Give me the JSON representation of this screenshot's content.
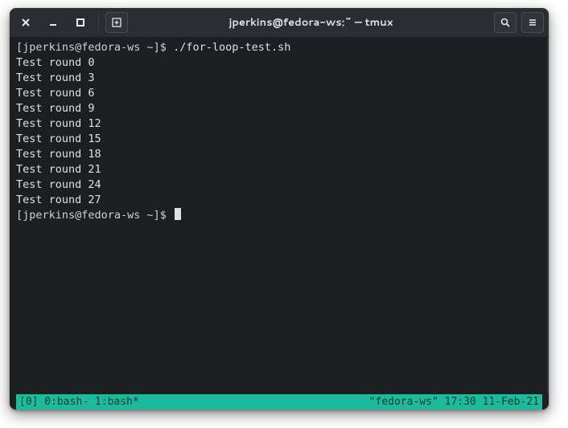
{
  "titlebar": {
    "title": "jperkins@fedora-ws:~ — tmux"
  },
  "terminal": {
    "prompt": "[jperkins@fedora-ws ~]$",
    "command": "./for-loop-test.sh",
    "output": [
      "Test round 0",
      "Test round 3",
      "Test round 6",
      "Test round 9",
      "Test round 12",
      "Test round 15",
      "Test round 18",
      "Test round 21",
      "Test round 24",
      "Test round 27"
    ],
    "prompt2": "[jperkins@fedora-ws ~]$"
  },
  "statusbar": {
    "left": "[0] 0:bash- 1:bash*",
    "right": "\"fedora-ws\" 17:30 11-Feb-21"
  }
}
